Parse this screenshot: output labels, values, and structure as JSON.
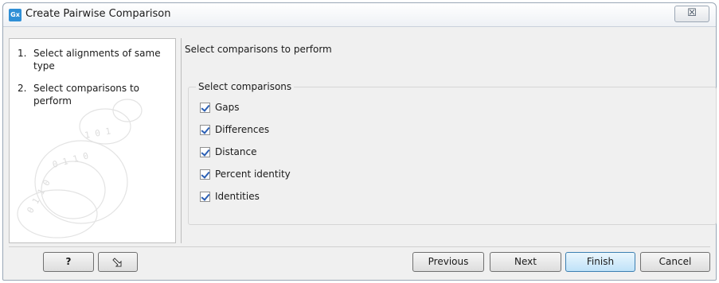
{
  "window": {
    "title": "Create Pairwise Comparison",
    "icon_label": "Gx",
    "close_glyph": "☒"
  },
  "steps": [
    {
      "num": "1.",
      "label": "Select alignments of same type"
    },
    {
      "num": "2.",
      "label": "Select comparisons to perform"
    }
  ],
  "main": {
    "heading": "Select comparisons to perform",
    "group_label": "Select comparisons",
    "options": [
      {
        "label": "Gaps",
        "checked": true
      },
      {
        "label": "Differences",
        "checked": true
      },
      {
        "label": "Distance",
        "checked": true
      },
      {
        "label": "Percent identity",
        "checked": true
      },
      {
        "label": "Identities",
        "checked": true
      }
    ]
  },
  "footer": {
    "help_label": "?",
    "reset_icon": "reset-icon",
    "previous_label": "Previous",
    "next_label": "Next",
    "finish_label": "Finish",
    "cancel_label": "Cancel"
  },
  "colors": {
    "accent": "#2f8fd6",
    "check": "#2b5fb4"
  }
}
